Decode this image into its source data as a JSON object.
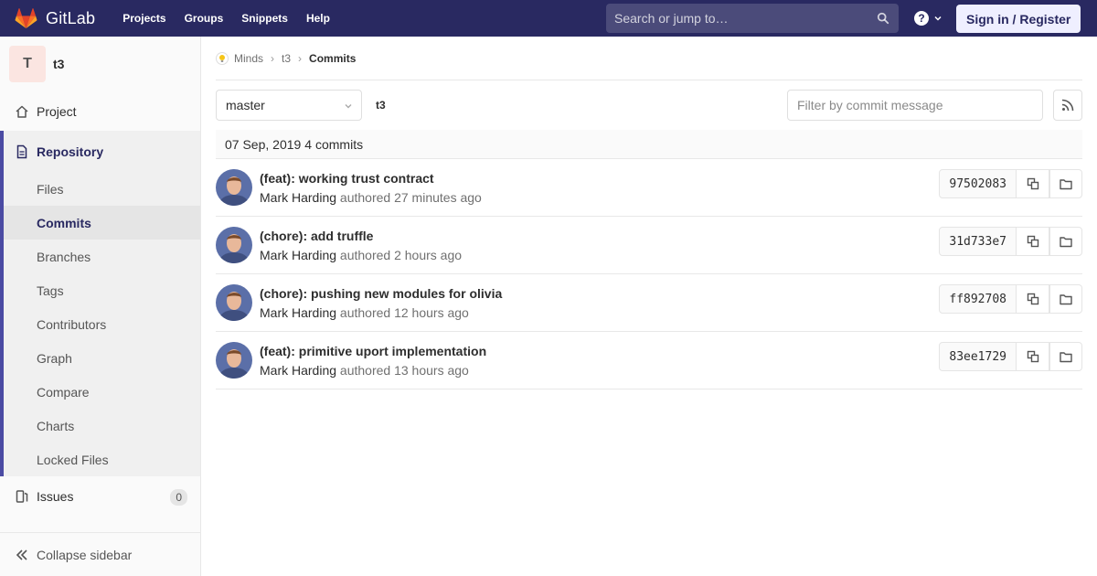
{
  "navbar": {
    "brand": "GitLab",
    "links": [
      "Projects",
      "Groups",
      "Snippets",
      "Help"
    ],
    "search_placeholder": "Search or jump to…",
    "sign_in": "Sign in / Register",
    "accent": "#292961"
  },
  "sidebar": {
    "project_initial": "T",
    "project_name": "t3",
    "project_label": "Project",
    "repository_label": "Repository",
    "repo_items": [
      "Files",
      "Commits",
      "Branches",
      "Tags",
      "Contributors",
      "Graph",
      "Compare",
      "Charts",
      "Locked Files"
    ],
    "issues_label": "Issues",
    "issues_count": "0",
    "collapse_label": "Collapse sidebar"
  },
  "breadcrumb": {
    "group": "Minds",
    "project": "t3",
    "current": "Commits"
  },
  "toolbar": {
    "branch": "master",
    "path": "t3",
    "filter_placeholder": "Filter by commit message"
  },
  "day": {
    "date": "07 Sep, 2019",
    "count": "4 commits"
  },
  "commits": [
    {
      "title": "(feat): working trust contract",
      "author": "Mark Harding",
      "verb": "authored",
      "time": "27 minutes ago",
      "sha": "97502083"
    },
    {
      "title": "(chore): add truffle",
      "author": "Mark Harding",
      "verb": "authored",
      "time": "2 hours ago",
      "sha": "31d733e7"
    },
    {
      "title": "(chore): pushing new modules for olivia",
      "author": "Mark Harding",
      "verb": "authored",
      "time": "12 hours ago",
      "sha": "ff892708"
    },
    {
      "title": "(feat): primitive uport implementation",
      "author": "Mark Harding",
      "verb": "authored",
      "time": "13 hours ago",
      "sha": "83ee1729"
    }
  ]
}
